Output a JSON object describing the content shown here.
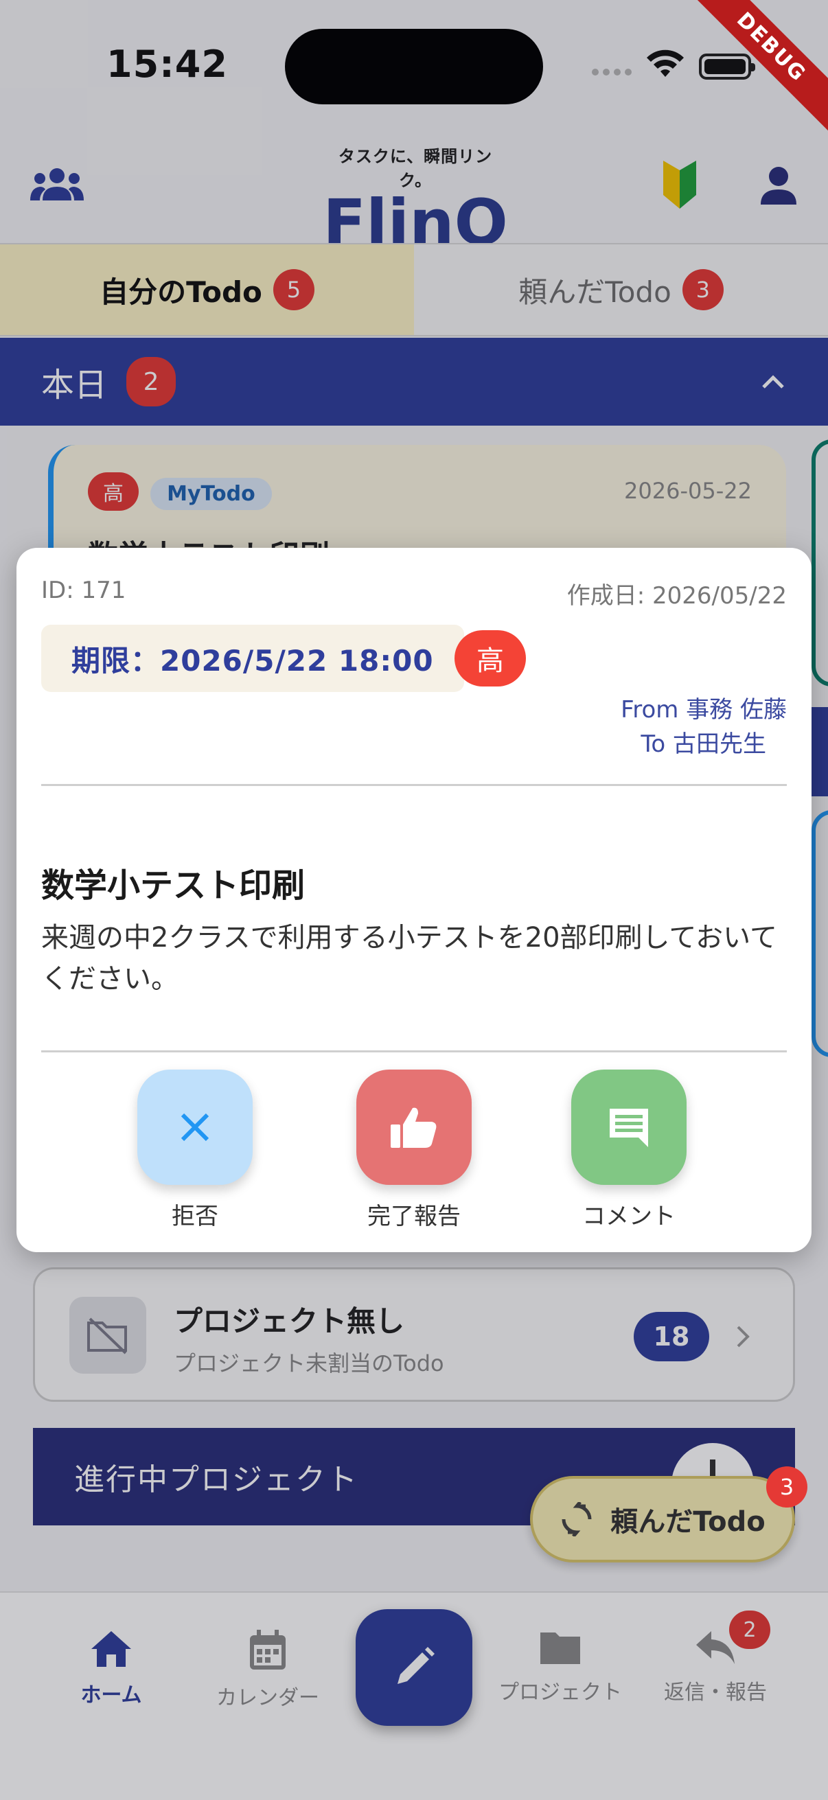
{
  "status_bar": {
    "time": "15:42",
    "debug": "DEBUG"
  },
  "header": {
    "logo_tagline": "タスクに、瞬間リンク。",
    "logo_text": "FlinQ"
  },
  "tabs": [
    {
      "label": "自分のTodo",
      "count": "5"
    },
    {
      "label": "頼んだTodo",
      "count": "3"
    }
  ],
  "section_today": {
    "label": "本日",
    "count": "2"
  },
  "card": {
    "priority": "高",
    "tag": "MyTodo",
    "date": "2026-05-22",
    "title": "数学小テスト印刷"
  },
  "modal": {
    "id": "ID: 171",
    "created": "作成日: 2026/05/22",
    "deadline": "期限：2026/5/22 18:00",
    "priority": "高",
    "from": "From 事務 佐藤",
    "to": "To 古田先生",
    "title": "数学小テスト印刷",
    "description": "来週の中2クラスで利用する小テストを20部印刷しておいてください。",
    "actions": [
      {
        "label": "拒否",
        "icon": "close-icon",
        "color": "#bfe0fb"
      },
      {
        "label": "完了報告",
        "icon": "thumbs-up-icon",
        "color": "#e57373"
      },
      {
        "label": "コメント",
        "icon": "comment-icon",
        "color": "#81c784"
      }
    ]
  },
  "no_project": {
    "title": "プロジェクト無し",
    "subtitle": "プロジェクト未割当のTodo",
    "count": "18"
  },
  "in_progress": {
    "label": "進行中プロジェクト"
  },
  "fab": {
    "label": "頼んだTodo",
    "badge": "3"
  },
  "bottom_nav": {
    "home": "ホーム",
    "calendar": "カレンダー",
    "project": "プロジェクト",
    "reply": "返信・報告",
    "reply_badge": "2"
  },
  "colors": {
    "primary": "#2f3e9c",
    "danger": "#e53935",
    "active_tab": "#fbf3c6"
  }
}
